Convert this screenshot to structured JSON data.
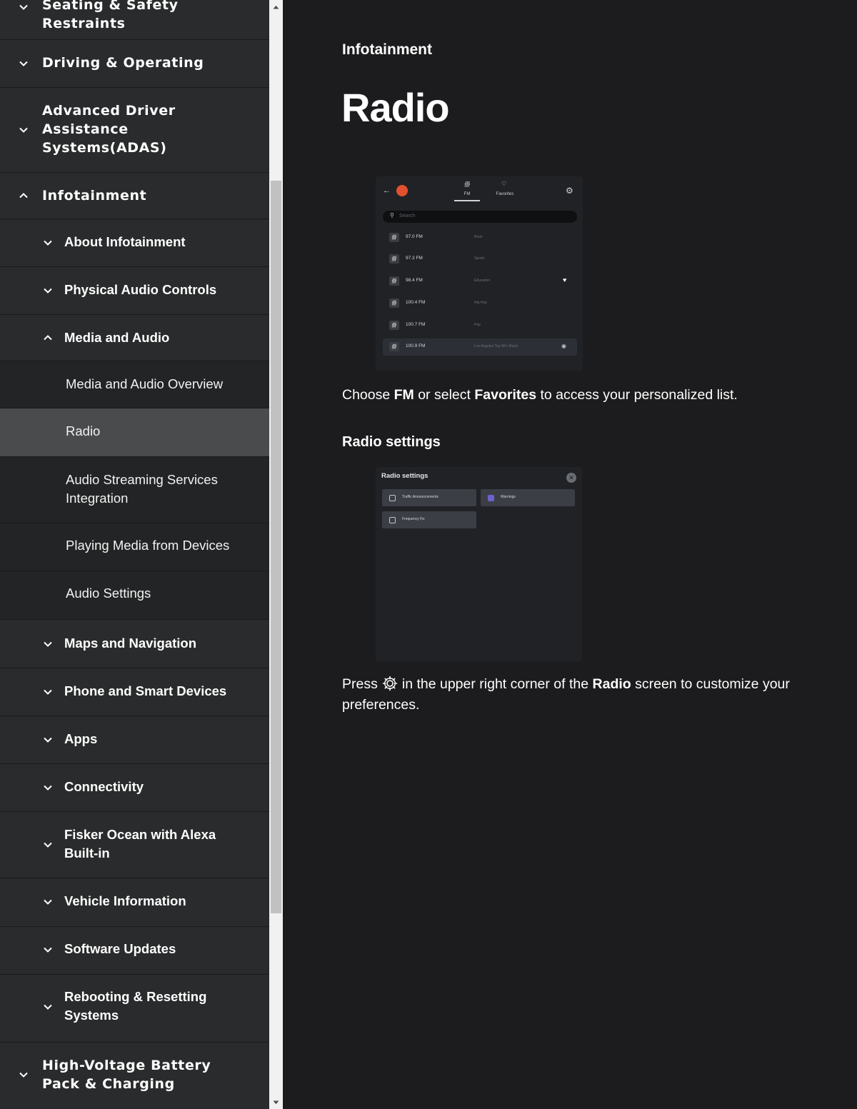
{
  "sidebar": {
    "items": [
      {
        "label": "Seating & Safety Restraints",
        "level": 1,
        "expanded": false
      },
      {
        "label": "Driving & Operating",
        "level": 1,
        "expanded": false
      },
      {
        "label": "Advanced Driver Assistance Systems(ADAS)",
        "level": 1,
        "expanded": false
      },
      {
        "label": "Infotainment",
        "level": 1,
        "expanded": true
      },
      {
        "label": "About Infotainment",
        "level": 2,
        "expanded": false
      },
      {
        "label": "Physical Audio Controls",
        "level": 2,
        "expanded": false
      },
      {
        "label": "Media and Audio",
        "level": 2,
        "expanded": true
      },
      {
        "label": "Media and Audio Overview",
        "level": 3
      },
      {
        "label": "Radio",
        "level": 3,
        "selected": true
      },
      {
        "label": "Audio Streaming Services Integration",
        "level": 3
      },
      {
        "label": "Playing Media from Devices",
        "level": 3
      },
      {
        "label": "Audio Settings",
        "level": 3
      },
      {
        "label": "Maps and Navigation",
        "level": 2,
        "expanded": false
      },
      {
        "label": "Phone and Smart Devices",
        "level": 2,
        "expanded": false
      },
      {
        "label": "Apps",
        "level": 2,
        "expanded": false
      },
      {
        "label": "Connectivity",
        "level": 2,
        "expanded": false
      },
      {
        "label": "Fisker Ocean with Alexa Built-in",
        "level": 2,
        "expanded": false
      },
      {
        "label": "Vehicle Information",
        "level": 2,
        "expanded": false
      },
      {
        "label": "Software Updates",
        "level": 2,
        "expanded": false
      },
      {
        "label": "Rebooting & Resetting Systems",
        "level": 2,
        "expanded": false
      },
      {
        "label": "High-Voltage Battery Pack & Charging",
        "level": 1,
        "expanded": false
      }
    ]
  },
  "main": {
    "breadcrumb": "Infotainment",
    "title": "Radio",
    "intro": {
      "pre": "Choose ",
      "fm": "FM",
      "mid": " or select ",
      "favorites": "Favorites",
      "post": " to access your personalized list."
    },
    "section_heading": "Radio settings",
    "settings_text": {
      "pre": "Press",
      "mid": "in the upper right corner of the ",
      "radio": "Radio",
      "post": " screen to customize your preferences."
    }
  },
  "radio_screenshot": {
    "back_icon": "arrow-left-icon",
    "tabs": [
      {
        "label": "FM",
        "icon": "antenna-icon"
      },
      {
        "label": "Favorites",
        "icon": "heart-icon"
      }
    ],
    "search_placeholder": "Search",
    "stations": [
      {
        "freq": "97.0 FM",
        "genre": "Rock"
      },
      {
        "freq": "97.3 FM",
        "genre": "Sports"
      },
      {
        "freq": "98.4 FM",
        "genre": "Education",
        "favorite": true
      },
      {
        "freq": "100.4 FM",
        "genre": "Hip Hop"
      },
      {
        "freq": "100.7 FM",
        "genre": "Pop"
      },
      {
        "freq": "100.9 FM",
        "genre": "Los Angeles Top 80's Music",
        "playing": true
      }
    ]
  },
  "settings_screenshot": {
    "title": "Radio settings",
    "options": [
      {
        "label": "Traffic Announcements",
        "checked": false
      },
      {
        "label": "Warnings",
        "checked": true
      },
      {
        "label": "Frequency Fix",
        "checked": false
      }
    ]
  },
  "colors": {
    "background": "#1c1c1e",
    "sidebar": "#2a2b2c",
    "sidebar_selected": "#4a4b4d",
    "checkbox_accent": "#6b63c9",
    "logo": "#e2512d"
  }
}
